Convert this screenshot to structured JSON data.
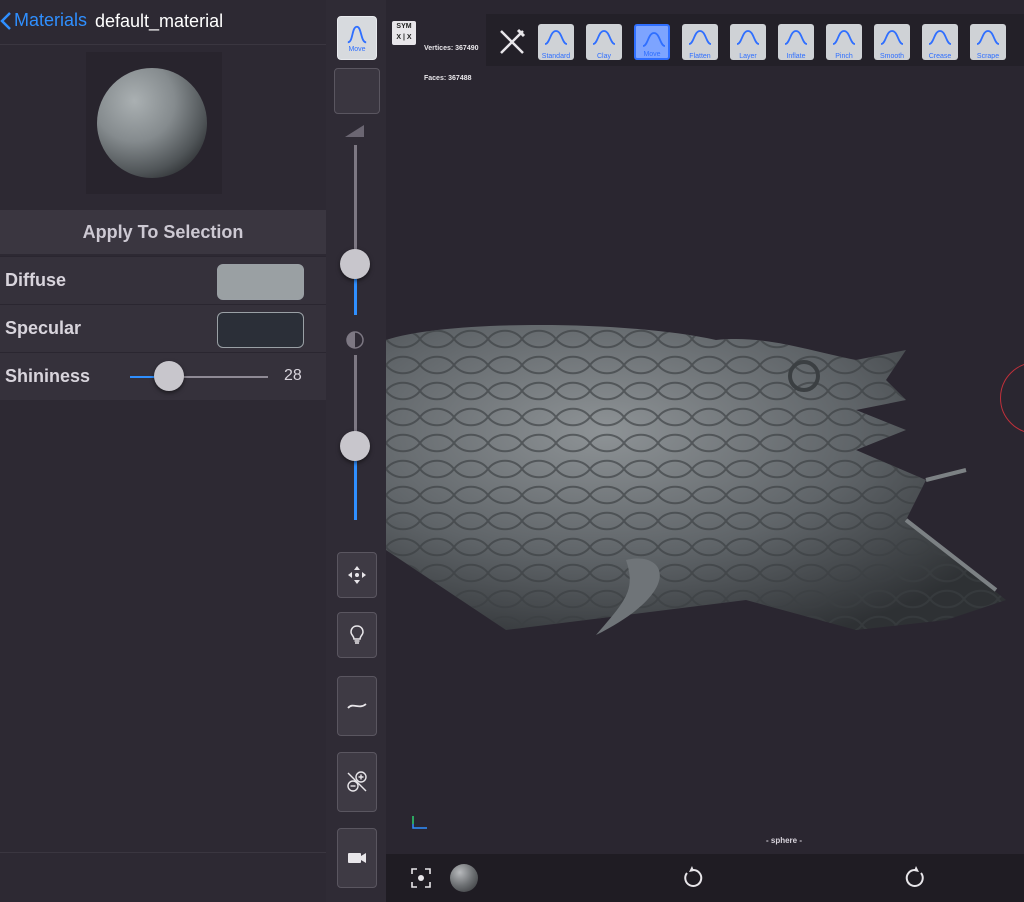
{
  "header": {
    "back_label": "Materials",
    "title": "default_material"
  },
  "material": {
    "apply_label": "Apply To Selection",
    "diffuse_label": "Diffuse",
    "diffuse_color": "#9aa0a3",
    "specular_label": "Specular",
    "specular_color": "#2b2f38",
    "shininess_label": "Shininess",
    "shininess_value": "28",
    "shininess_fraction": 0.28
  },
  "left_toolbar": {
    "move_label": "Move",
    "radius_fraction": 0.3,
    "intensity_fraction": 0.45
  },
  "topbar": {
    "sym_label": "SYM",
    "sym_axis": "X | X",
    "vertices_label": "Vertices:",
    "vertices_value": "367490",
    "faces_label": "Faces:",
    "faces_value": "367488"
  },
  "brushes": [
    {
      "label": "Standard",
      "active": false
    },
    {
      "label": "Clay",
      "active": false
    },
    {
      "label": "Move",
      "active": true
    },
    {
      "label": "Flatten",
      "active": false
    },
    {
      "label": "Layer",
      "active": false
    },
    {
      "label": "Inflate",
      "active": false
    },
    {
      "label": "Pinch",
      "active": false
    },
    {
      "label": "Smooth",
      "active": false
    },
    {
      "label": "Crease",
      "active": false
    },
    {
      "label": "Scrape",
      "active": false
    }
  ],
  "viewport": {
    "object_label": "- sphere -"
  },
  "colors": {
    "accent": "#2f8fff",
    "background": "#2a2630",
    "panel": "#2d2933"
  }
}
